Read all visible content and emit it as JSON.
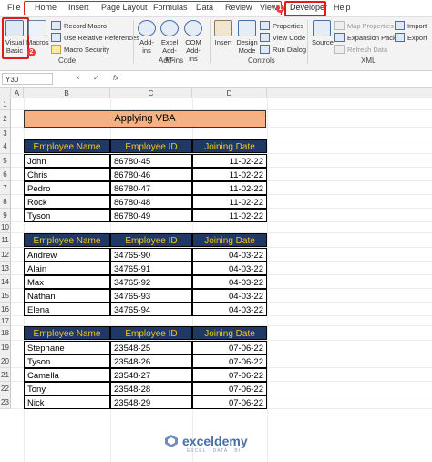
{
  "tabs": [
    "File",
    "Home",
    "Insert",
    "Page Layout",
    "Formulas",
    "Data",
    "Review",
    "View",
    "Developer",
    "Help"
  ],
  "badges": {
    "one": "1",
    "two": "2"
  },
  "ribbon": {
    "code": {
      "label": "Code",
      "visual_basic": "Visual Basic",
      "macros": "Macros",
      "record_macro": "Record Macro",
      "relative_refs": "Use Relative References",
      "macro_security": "Macro Security"
    },
    "addins": {
      "label": "Add-ins",
      "addins": "Add-ins",
      "excel_addins": "Excel Add-ins",
      "com_addins": "COM Add-ins"
    },
    "controls": {
      "label": "Controls",
      "insert": "Insert",
      "design_mode": "Design Mode",
      "properties": "Properties",
      "view_code": "View Code",
      "run_dialog": "Run Dialog"
    },
    "xml": {
      "label": "XML",
      "source": "Source",
      "map_properties": "Map Properties",
      "expansion_packs": "Expansion Packs",
      "refresh_data": "Refresh Data",
      "import": "Import",
      "export": "Export"
    }
  },
  "formula_bar": {
    "name_box": "Y30",
    "cancel": "×",
    "enter": "✓",
    "fx": "fx",
    "content": ""
  },
  "columns": [
    "A",
    "B",
    "C",
    "D"
  ],
  "rows": [
    "1",
    "2",
    "3",
    "4",
    "5",
    "6",
    "7",
    "8",
    "9",
    "10",
    "11",
    "12",
    "13",
    "14",
    "15",
    "16",
    "17",
    "18",
    "19",
    "20",
    "21",
    "22",
    "23"
  ],
  "title": "Applying VBA",
  "tables": [
    {
      "headers": [
        "Employee Name",
        "Employee ID",
        "Joining Date"
      ],
      "rows": [
        [
          "John",
          "86780-45",
          "11-02-22"
        ],
        [
          "Chris",
          "86780-46",
          "11-02-22"
        ],
        [
          "Pedro",
          "86780-47",
          "11-02-22"
        ],
        [
          "Rock",
          "86780-48",
          "11-02-22"
        ],
        [
          "Tyson",
          "86780-49",
          "11-02-22"
        ]
      ]
    },
    {
      "headers": [
        "Employee Name",
        "Employee ID",
        "Joining Date"
      ],
      "rows": [
        [
          "Andrew",
          "34765-90",
          "04-03-22"
        ],
        [
          "Alain",
          "34765-91",
          "04-03-22"
        ],
        [
          "Max",
          "34765-92",
          "04-03-22"
        ],
        [
          "Nathan",
          "34765-93",
          "04-03-22"
        ],
        [
          "Elena",
          "34765-94",
          "04-03-22"
        ]
      ]
    },
    {
      "headers": [
        "Employee Name",
        "Employee ID",
        "Joining Date"
      ],
      "rows": [
        [
          "Stephane",
          "23548-25",
          "07-06-22"
        ],
        [
          "Tyson",
          "23548-26",
          "07-06-22"
        ],
        [
          "Camella",
          "23548-27",
          "07-06-22"
        ],
        [
          "Tony",
          "23548-28",
          "07-06-22"
        ],
        [
          "Nick",
          "23548-29",
          "07-06-22"
        ]
      ]
    }
  ],
  "watermark": {
    "name": "exceldemy",
    "tagline": "EXCEL · DATA · BI"
  },
  "colors": {
    "header_bg": "#1f3864",
    "header_text": "#f5c518",
    "title_bg": "#f4b183",
    "highlight": "#e01b1b"
  }
}
